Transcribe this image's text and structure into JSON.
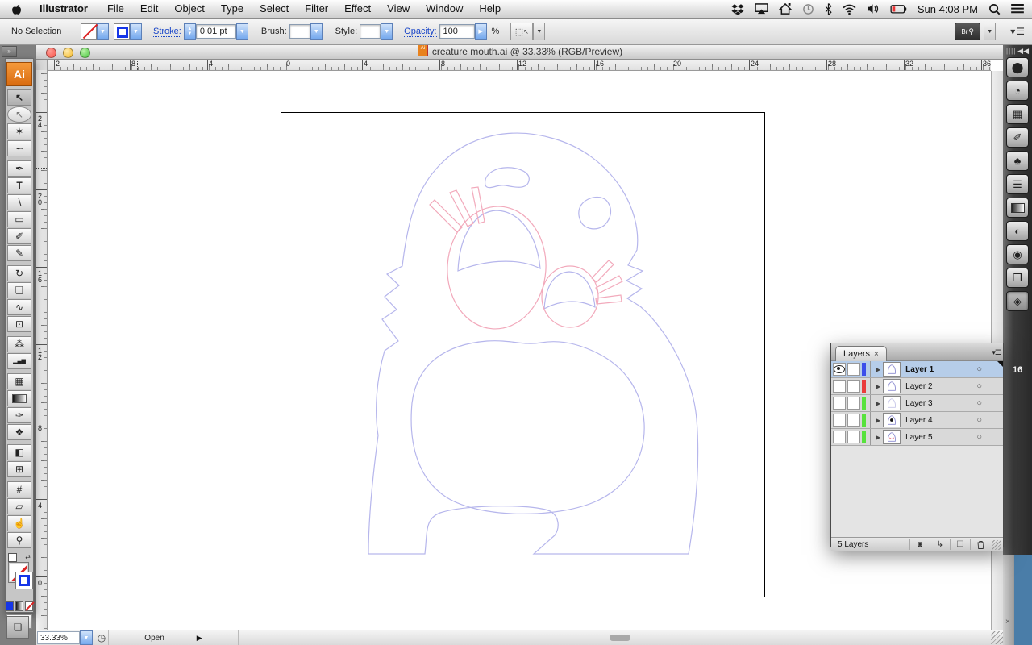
{
  "menu_bar": {
    "app_menu": "Illustrator",
    "items": [
      "File",
      "Edit",
      "Object",
      "Type",
      "Select",
      "Filter",
      "Effect",
      "View",
      "Window",
      "Help"
    ],
    "clock": "Sun 4:08 PM",
    "status_icons": [
      "dropbox-icon",
      "airplay-icon",
      "home-sync-icon",
      "time-machine-icon",
      "bluetooth-icon",
      "wifi-icon",
      "volume-icon",
      "battery-icon",
      "spotlight-icon",
      "menu-list-icon"
    ]
  },
  "control_bar": {
    "selection_status": "No Selection",
    "stroke_label": "Stroke:",
    "stroke_value": "0.01 pt",
    "brush_label": "Brush:",
    "style_label": "Style:",
    "opacity_label": "Opacity:",
    "opacity_value": "100",
    "percent_sign": "%",
    "bridge_label": "Br"
  },
  "document_window": {
    "title": "creature mouth.ai @ 33.33% (RGB/Preview)",
    "zoom_value": "33.33%",
    "status_text": "Open"
  },
  "rulers": {
    "horizontal_labels": [
      "2",
      "8",
      "4",
      "0",
      "4",
      "8",
      "12",
      "16",
      "20",
      "24",
      "28",
      "32",
      "36"
    ],
    "horizontal_positions": [
      8,
      102,
      198,
      294,
      390,
      486,
      582,
      678,
      774,
      870,
      966,
      1062,
      1158
    ],
    "vertical_labels": [
      "24",
      "20",
      "16",
      "12",
      "8",
      "4",
      "0"
    ],
    "vertical_positions": [
      52,
      148,
      244,
      340,
      436,
      532,
      628
    ]
  },
  "toolbar": {
    "tools": [
      {
        "name": "selection-tool",
        "glyph": "↖",
        "cls": "bold active"
      },
      {
        "name": "direct-selection-tool",
        "glyph": "↖",
        "cls": "light"
      },
      {
        "name": "magic-wand-tool",
        "glyph": "✶",
        "cls": ""
      },
      {
        "name": "lasso-tool",
        "glyph": "∽",
        "cls": ""
      },
      {
        "name": "pen-tool",
        "glyph": "✒",
        "cls": ""
      },
      {
        "name": "type-tool",
        "glyph": "T",
        "cls": "bold"
      },
      {
        "name": "line-segment-tool",
        "glyph": "∖",
        "cls": ""
      },
      {
        "name": "rectangle-tool",
        "glyph": "▭",
        "cls": ""
      },
      {
        "name": "paintbrush-tool",
        "glyph": "✐",
        "cls": ""
      },
      {
        "name": "pencil-tool",
        "glyph": "✎",
        "cls": ""
      },
      {
        "name": "rotate-tool",
        "glyph": "↻",
        "cls": ""
      },
      {
        "name": "scale-tool",
        "glyph": "❏",
        "cls": ""
      },
      {
        "name": "warp-tool",
        "glyph": "∿",
        "cls": ""
      },
      {
        "name": "free-transform-tool",
        "glyph": "⊡",
        "cls": ""
      },
      {
        "name": "symbol-sprayer-tool",
        "glyph": "⁂",
        "cls": ""
      },
      {
        "name": "column-graph-tool",
        "glyph": "▂▄▆",
        "cls": "tiny"
      },
      {
        "name": "mesh-tool",
        "glyph": "▦",
        "cls": ""
      },
      {
        "name": "gradient-tool",
        "glyph": "",
        "cls": "grad"
      },
      {
        "name": "eyedropper-tool",
        "glyph": "✑",
        "cls": ""
      },
      {
        "name": "blend-tool",
        "glyph": "❖",
        "cls": ""
      },
      {
        "name": "live-paint-bucket-tool",
        "glyph": "◧",
        "cls": ""
      },
      {
        "name": "live-paint-selection-tool",
        "glyph": "⊞",
        "cls": ""
      },
      {
        "name": "crop-area-tool",
        "glyph": "#",
        "cls": ""
      },
      {
        "name": "eraser-tool",
        "glyph": "▱",
        "cls": ""
      },
      {
        "name": "hand-tool",
        "glyph": "☝",
        "cls": ""
      },
      {
        "name": "zoom-tool",
        "glyph": "⚲",
        "cls": ""
      }
    ],
    "group_breaks": [
      3,
      9,
      13,
      15,
      19,
      21
    ]
  },
  "dock": {
    "panels": [
      {
        "name": "color-panel",
        "glyph": "⬤"
      },
      {
        "name": "color-guide-panel",
        "glyph": "◔"
      },
      {
        "name": "swatches-panel",
        "glyph": "▦"
      },
      {
        "name": "brushes-panel",
        "glyph": "✐"
      },
      {
        "name": "symbols-panel",
        "glyph": "♣"
      },
      {
        "name": "stroke-panel",
        "glyph": "☰"
      },
      {
        "name": "gradient-panel",
        "glyph": "",
        "cls": "grad"
      },
      {
        "name": "transparency-panel",
        "glyph": "◐"
      },
      {
        "name": "appearance-panel",
        "glyph": "◉"
      },
      {
        "name": "graphic-styles-panel",
        "glyph": "❐"
      },
      {
        "name": "layers-panel-icon",
        "glyph": "◈",
        "active": true
      }
    ],
    "group_breaks": [
      1,
      4,
      7,
      9
    ],
    "stray_number": "16"
  },
  "layers_panel": {
    "tab_label": "Layers",
    "close_glyph": "×",
    "rows": [
      {
        "name": "Layer 1",
        "color": "#3b4eea",
        "visible": true,
        "selected": true,
        "thumb": "body"
      },
      {
        "name": "Layer 2",
        "color": "#ea3b3b",
        "visible": false,
        "selected": false,
        "thumb": "body"
      },
      {
        "name": "Layer 3",
        "color": "#57e23c",
        "visible": false,
        "selected": false,
        "thumb": "light"
      },
      {
        "name": "Layer 4",
        "color": "#57e23c",
        "visible": false,
        "selected": false,
        "thumb": "eye"
      },
      {
        "name": "Layer 5",
        "color": "#57e23c",
        "visible": false,
        "selected": false,
        "thumb": "mouth"
      }
    ],
    "footer_label": "5 Layers"
  },
  "artwork": {
    "outline_color": "#b6b6ec",
    "accent_color": "#f2a9bb",
    "desktop_color": "#4a7da8"
  }
}
